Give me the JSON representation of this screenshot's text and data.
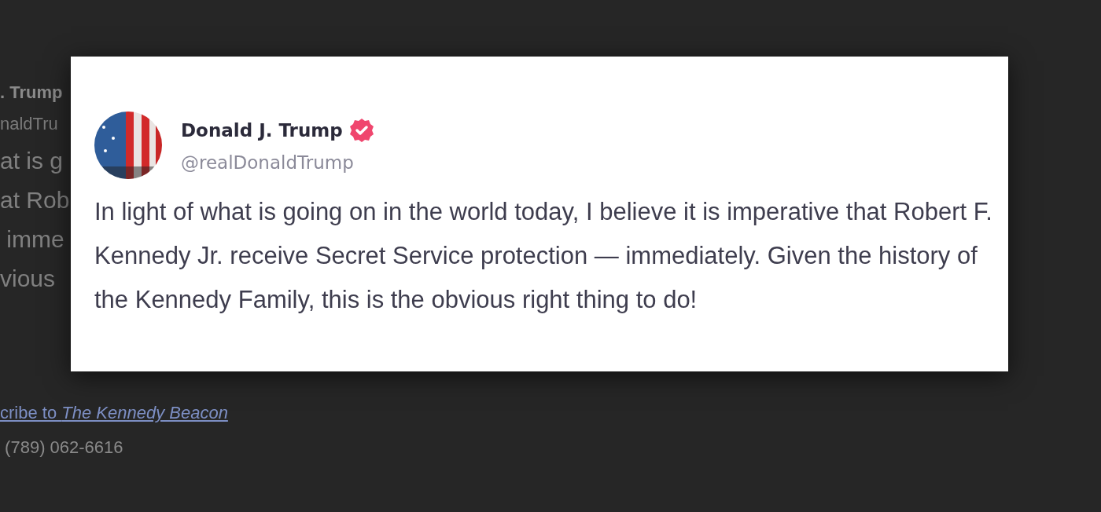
{
  "background_page": {
    "author_fragment": ". Trump",
    "handle_fragment": "naldTru",
    "body_fragments": [
      "at is g",
      "at Rob",
      " imme",
      "vious"
    ],
    "subscribe_link": "cribe to *The Kennedy Beacon* ",
    "phone": "(789) 062-6616"
  },
  "post_modal": {
    "author": {
      "name": "Donald J. Trump",
      "verified": true,
      "handle": "@realDonaldTrump"
    },
    "text": "In light of what is going on in the world today, I believe it is imperative that Robert F. Kennedy Jr. receive Secret Service protection — immediately. Given the history of the Kennedy Family, this is the obvious right thing to do!"
  }
}
